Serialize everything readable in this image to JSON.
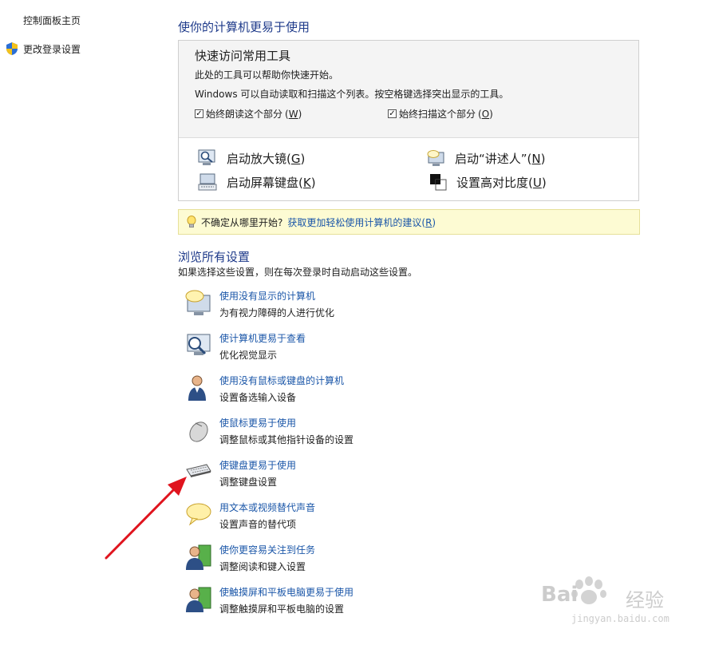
{
  "sidebar": {
    "home": "控制面板主页",
    "login_settings": "更改登录设置"
  },
  "main": {
    "title": "使你的计算机更易于使用",
    "quick": {
      "title": "快速访问常用工具",
      "line1": "此处的工具可以帮助你快速开始。",
      "line2": "Windows 可以自动读取和扫描这个列表。按空格键选择突出显示的工具。",
      "checkbox_read": {
        "label": "始终朗读这个部分",
        "key": "W"
      },
      "checkbox_scan": {
        "label": "始终扫描这个部分",
        "key": "O"
      },
      "tools": [
        {
          "label": "启动放大镜",
          "key": "G"
        },
        {
          "label": "启动“讲述人”",
          "key": "N"
        },
        {
          "label": "启动屏幕键盘",
          "key": "K"
        },
        {
          "label": "设置高对比度",
          "key": "U"
        }
      ]
    },
    "tip": {
      "text": "不确定从哪里开始?",
      "link": "获取更加轻松使用计算机的建议",
      "key": "R"
    },
    "browse": {
      "title": "浏览所有设置",
      "subtitle": "如果选择这些设置，则在每次登录时自动启动这些设置。",
      "items": [
        {
          "link": "使用没有显示的计算机",
          "desc": "为有视力障碍的人进行优化",
          "icon": "speech-bubble-monitor-icon"
        },
        {
          "link": "使计算机更易于查看",
          "desc": "优化视觉显示",
          "icon": "magnifier-monitor-icon"
        },
        {
          "link": "使用没有鼠标或键盘的计算机",
          "desc": "设置备选输入设备",
          "icon": "person-icon"
        },
        {
          "link": "使鼠标更易于使用",
          "desc": "调整鼠标或其他指针设备的设置",
          "icon": "mouse-icon"
        },
        {
          "link": "使键盘更易于使用",
          "desc": "调整键盘设置",
          "icon": "keyboard-icon"
        },
        {
          "link": "用文本或视频替代声音",
          "desc": "设置声音的替代项",
          "icon": "speech-bubble-icon"
        },
        {
          "link": "使你更容易关注到任务",
          "desc": "调整阅读和键入设置",
          "icon": "person-document-icon"
        },
        {
          "link": "使触摸屏和平板电脑更易于使用",
          "desc": "调整触摸屏和平板电脑的设置",
          "icon": "person-tablet-icon"
        }
      ]
    }
  },
  "watermark": {
    "brand": "Bai",
    "brand2": "经验",
    "url": "jingyan.baidu.com"
  },
  "colors": {
    "link": "#1a56a8",
    "heading": "#1e3a8a",
    "tip_bg": "#fdfbd3",
    "arrow": "#e0141e"
  }
}
